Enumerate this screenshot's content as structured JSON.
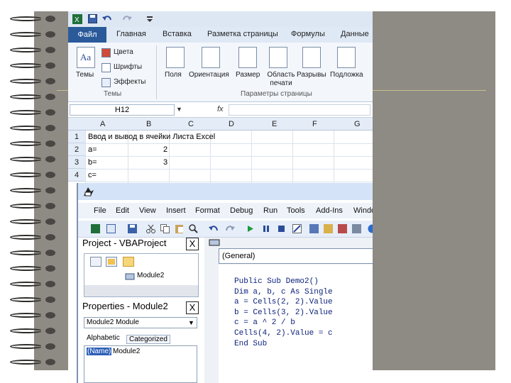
{
  "excel": {
    "quick_access_icons": [
      "excel-logo-icon",
      "save-icon",
      "undo-icon",
      "redo-icon",
      "customize-icon"
    ],
    "ribbon_tabs": [
      "Файл",
      "Главная",
      "Вставка",
      "Разметка страницы",
      "Формулы",
      "Данные"
    ],
    "themes_group": {
      "themes_label": "Темы",
      "colors_label": "Цвета",
      "fonts_label": "Шрифты",
      "effects_label": "Эффекты",
      "group_label": "Темы"
    },
    "page_setup_group": {
      "buttons": [
        "Поля",
        "Ориентация",
        "Размер",
        "Область печати",
        "Разрывы",
        "Подложка"
      ],
      "group_label": "Параметры страницы"
    },
    "name_box": "H12",
    "formula_symbol": "fx",
    "columns": [
      "A",
      "B",
      "C",
      "D",
      "E",
      "F",
      "G"
    ],
    "rows": [
      {
        "num": "1",
        "a": "Ввод и вывод  в ячейки Листа Excel",
        "b": ""
      },
      {
        "num": "2",
        "a": "a=",
        "b": "2"
      },
      {
        "num": "3",
        "a": "b=",
        "b": "3"
      },
      {
        "num": "4",
        "a": "c=",
        "b": ""
      }
    ]
  },
  "vba": {
    "menu": [
      "File",
      "Edit",
      "View",
      "Insert",
      "Format",
      "Debug",
      "Run",
      "Tools",
      "Add-Ins",
      "Window"
    ],
    "project_title": "Project - VBAProject",
    "tree_item": "Module2",
    "properties_title": "Properties - Module2",
    "properties_combo": "Module2 Module",
    "tabs": [
      "Alphabetic",
      "Categorized"
    ],
    "property_name": "(Name)",
    "property_value": "Module2",
    "close_symbol": "X",
    "code_combo": "(General)",
    "code_lines": [
      "Public Sub Demo2()",
      "Dim a, b, c As Single",
      "a = Cells(2, 2).Value",
      "b = Cells(3, 2).Value",
      "c = a ^ 2 / b",
      "Cells(4, 2).Value = c",
      "End Sub"
    ]
  },
  "colors": {
    "slide_panel": "#8e8a84",
    "file_tab": "#2a5a9a",
    "ribbon": "#dfe9f5",
    "code_text": "#0a1f7a"
  }
}
